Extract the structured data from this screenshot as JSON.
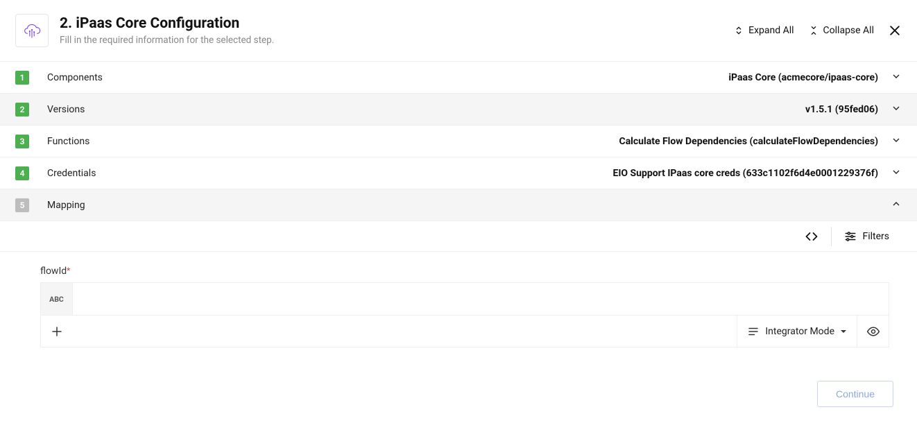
{
  "header": {
    "title": "2. iPaas Core Configuration",
    "subtitle": "Fill in the required information for the selected step.",
    "expand": "Expand All",
    "collapse": "Collapse All"
  },
  "rows": {
    "components": {
      "num": "1",
      "label": "Components",
      "value": "iPaas Core (acmecore/ipaas-core)"
    },
    "versions": {
      "num": "2",
      "label": "Versions",
      "value": "v1.5.1 (95fed06)"
    },
    "functions": {
      "num": "3",
      "label": "Functions",
      "value": "Calculate Flow Dependencies (calculateFlowDependencies)"
    },
    "credentials": {
      "num": "4",
      "label": "Credentials",
      "value": "EIO Support IPaas core creds (633c1102f6d4e0001229376f)"
    },
    "mapping": {
      "num": "5",
      "label": "Mapping",
      "value": ""
    }
  },
  "toolbar": {
    "filters": "Filters"
  },
  "mapping": {
    "field_label": "flowId",
    "required_marker": "*",
    "abc": "ABC",
    "input_value": "",
    "input_placeholder": "",
    "mode_label": "Integrator Mode"
  },
  "footer": {
    "continue": "Continue"
  }
}
